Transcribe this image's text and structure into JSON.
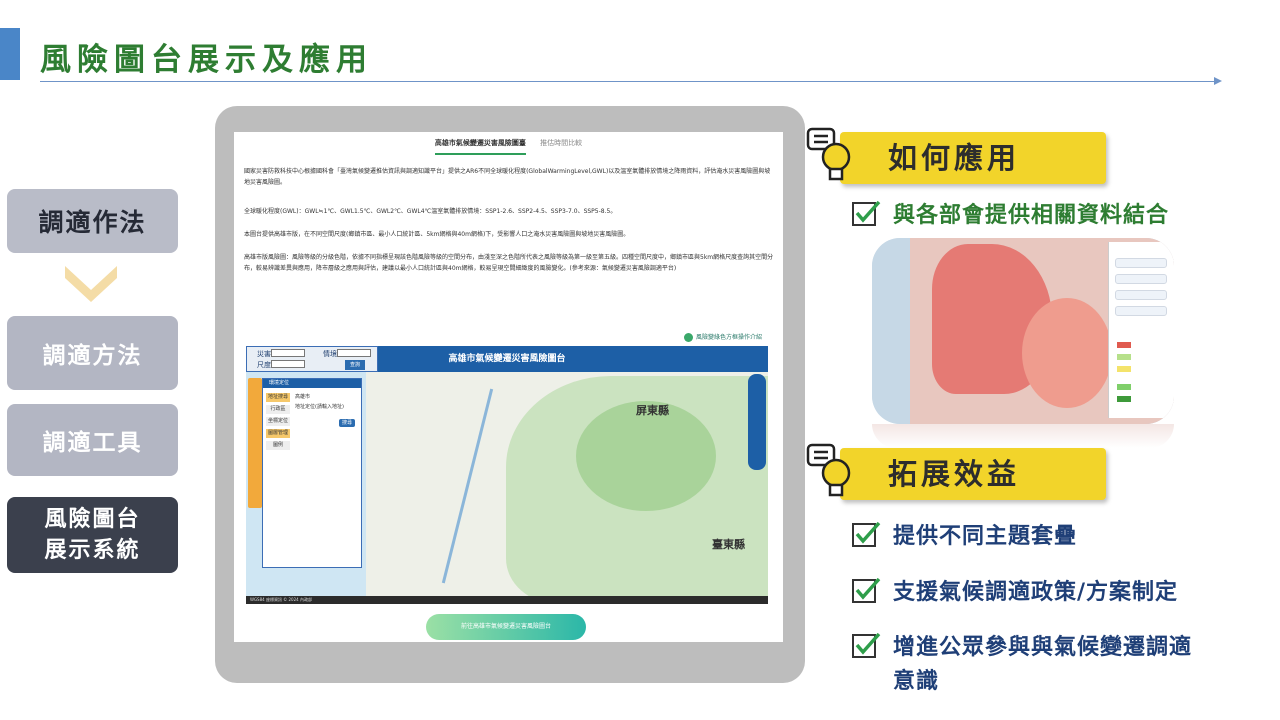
{
  "slide_title": "風險圖台展示及應用",
  "nav": {
    "main": "調適作法",
    "items": [
      "調適方法",
      "調適工具"
    ],
    "active_line1": "風險圖台",
    "active_line2": "展示系統"
  },
  "screen": {
    "tab_active": "高雄市氣候變遷災害風險圖臺",
    "tab_inactive": "推估時間比較",
    "paragraphs": [
      "國家災害防救科技中心根據國科會「臺灣氣候變遷推估資訊與調適知識平台」提供之AR6不同全球暖化程度(GlobalWarmingLevel,GWL)以及溫室氣體排放情境之降雨資料，評估淹水災害風險圖與坡地災害風險圖。",
      "全球暖化程度(GWL)：GWL≒1℃、GWL1.5℃、GWL2℃、GWL4℃溫室氣體排放情境：SSP1-2.6、SSP2-4.5、SSP3-7.0、SSP5-8.5。",
      "本圖台提供高雄市版，在不同空間尺度(鄉鎮市區、最小人口統計區、5km網格與40m網格)下，受影響人口之淹水災害風險圖與坡地災害風險圖。",
      "高雄市版風險圖：風險等級的分級色階，依據不同指標呈現該色階風險等級的空間分布，由淺至深之色階所代表之風險等級為第一級至第五級。四種空間尺度中，鄉鎮市區與5km網格尺度查詢其空間分布，較易辨識差異與應用，降市層級之應用與評估，建議以最小人口統計區與40m網格，較易呈現空間細緻度的風險變化。(參考來源：氣候變遷災害風險調適平台)"
    ],
    "info_link": "風險變綠色方框操作介紹",
    "map": {
      "banner": "高雄市氣候變遷災害風險圖台",
      "filter_label_1": "災害",
      "filter_label_2": "尺度",
      "filter_label_3": "情境",
      "query_button": "查詢",
      "panel_title": "環境定位",
      "panel_tabs": [
        "地址搜尋",
        "行政區",
        "坐標定位",
        "圖層管理",
        "圖例"
      ],
      "panel_line_1": "高雄市",
      "panel_line_2": "地址定位(請輸入地址)",
      "panel_button": "搜尋",
      "county_1": "屏東縣",
      "county_2": "臺東縣",
      "footer": "WGS84 座標資訊 © 2024 內政部"
    },
    "go_button": "前往高雄市氣候變遷災害風險圖台"
  },
  "right": {
    "section_1": "如何應用",
    "section_1_items": [
      "與各部會提供相關資料結合"
    ],
    "section_2": "拓展效益",
    "section_2_items": [
      "提供不同主題套疊",
      "支援氣候調適政策/方案制定",
      "增進公眾參與與氣候變遷調適意識"
    ]
  },
  "colors": {
    "title_green": "#2e7d32",
    "accent_blue": "#4a86c8",
    "tag_yellow": "#f2d42a",
    "check_text_blue": "#1f3f77",
    "nav_active": "#3b404d"
  }
}
